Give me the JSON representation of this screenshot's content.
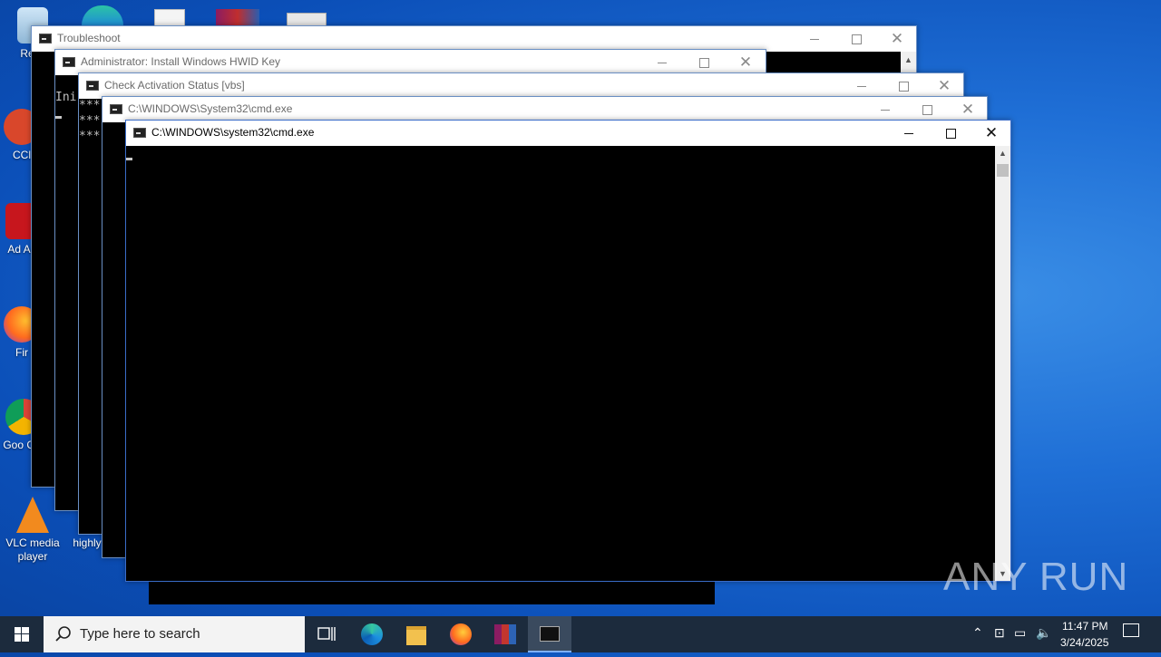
{
  "desktop_icons": [
    {
      "label": "Recy",
      "icon": "recycle-bin-icon"
    },
    {
      "label": "CCl",
      "icon": "ccleaner-icon"
    },
    {
      "label": "Ad Acr",
      "icon": "acrobat-icon"
    },
    {
      "label": "Fir",
      "icon": "firefox-icon"
    },
    {
      "label": "Goo Chr",
      "icon": "chrome-icon"
    },
    {
      "label": "VLC media player",
      "icon": "vlc-icon"
    },
    {
      "label": "highly",
      "icon": "file-icon"
    }
  ],
  "windows": {
    "w1": {
      "title": "Troubleshoot"
    },
    "w2": {
      "title": "Administrator:  Install Windows HWID Key",
      "text": "Ini"
    },
    "w3": {
      "title": "Check Activation Status [vbs]",
      "text": [
        "***",
        "***",
        "***"
      ]
    },
    "w4": {
      "title": "C:\\WINDOWS\\System32\\cmd.exe"
    },
    "w5": {
      "title": "C:\\WINDOWS\\system32\\cmd.exe"
    }
  },
  "controls": {
    "minimize": "—",
    "maximize": "☐",
    "close": "✕"
  },
  "taskbar": {
    "search_placeholder": "Type here to search",
    "time": "11:47 PM",
    "date": "3/24/2025",
    "apps": [
      "start-icon",
      "task-view-icon",
      "edge-icon",
      "file-explorer-icon",
      "firefox-icon",
      "winrar-icon",
      "cmd-icon"
    ]
  },
  "watermark": "ANY RUN",
  "colors": {
    "desktop": "#1f6fd6",
    "taskbar": "#1c2b3d",
    "terminal_bg": "#000000"
  }
}
